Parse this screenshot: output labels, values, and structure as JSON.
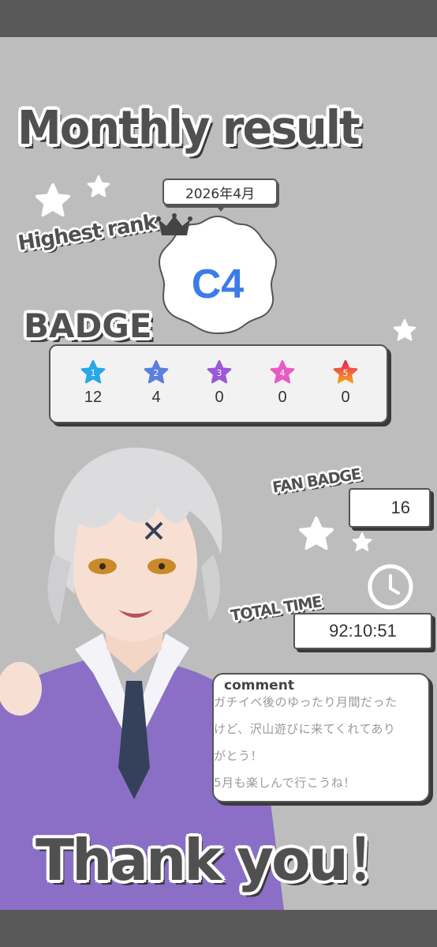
{
  "title": "Monthly result",
  "date": "2026年4月",
  "highest_rank": {
    "label": "Highest rank",
    "value": "C4"
  },
  "badge": {
    "label": "BADGE",
    "items": [
      {
        "num": "1",
        "count": "12",
        "color": "#29a7e8"
      },
      {
        "num": "2",
        "count": "4",
        "color": "#5b7fe0"
      },
      {
        "num": "3",
        "count": "0",
        "color": "#9b59d6"
      },
      {
        "num": "4",
        "count": "0",
        "color": "#e85cc2"
      },
      {
        "num": "5",
        "count": "0",
        "color": "#f04a6a"
      }
    ]
  },
  "fan_badge": {
    "label": "FAN BADGE",
    "value": "16"
  },
  "total_time": {
    "label": "TOTAL TIME",
    "value": "92:10:51"
  },
  "comment": {
    "label": "comment",
    "lines": [
      "ガチイベ後のゆったり月間だった",
      "けど、沢山遊びに来てくれてあり",
      "がとう！",
      "5月も楽しんで行こうね！"
    ]
  },
  "thanks": "Thank you！",
  "colors": {
    "accent": "#3b7ce8",
    "text": "#505050",
    "background": "#bdbdbd"
  }
}
